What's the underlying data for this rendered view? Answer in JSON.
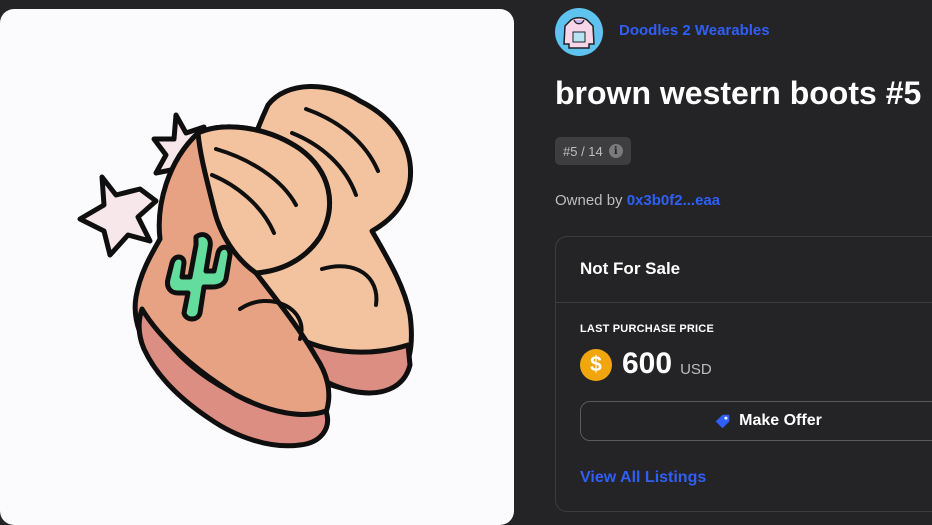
{
  "item_image": {
    "icon": "brown-western-boots-illustration",
    "colors": {
      "boot_dark": "#e7a183",
      "boot_light": "#f3c39f",
      "sole": "#dc8e82",
      "cactus": "#63dc9e",
      "star": "#f7e7ea",
      "outline": "#0f0f0f"
    }
  },
  "collection": {
    "name": "Doodles 2 Wearables",
    "avatar_icon": "hoodie-icon"
  },
  "item": {
    "title": "brown western boots #5",
    "edition": "#5 / 14",
    "owned_by_label": "Owned by",
    "owner": "0x3b0f2...eaa"
  },
  "sale_panel": {
    "status": "Not For Sale",
    "last_price_label": "LAST PURCHASE PRICE",
    "currency_symbol": "$",
    "price": "600",
    "currency": "USD",
    "make_offer_label": "Make Offer",
    "view_all_label": "View All Listings"
  },
  "colors": {
    "background": "#242426",
    "link": "#2f5ff5",
    "coin": "#f2a60d",
    "border": "#3c3c3e"
  }
}
